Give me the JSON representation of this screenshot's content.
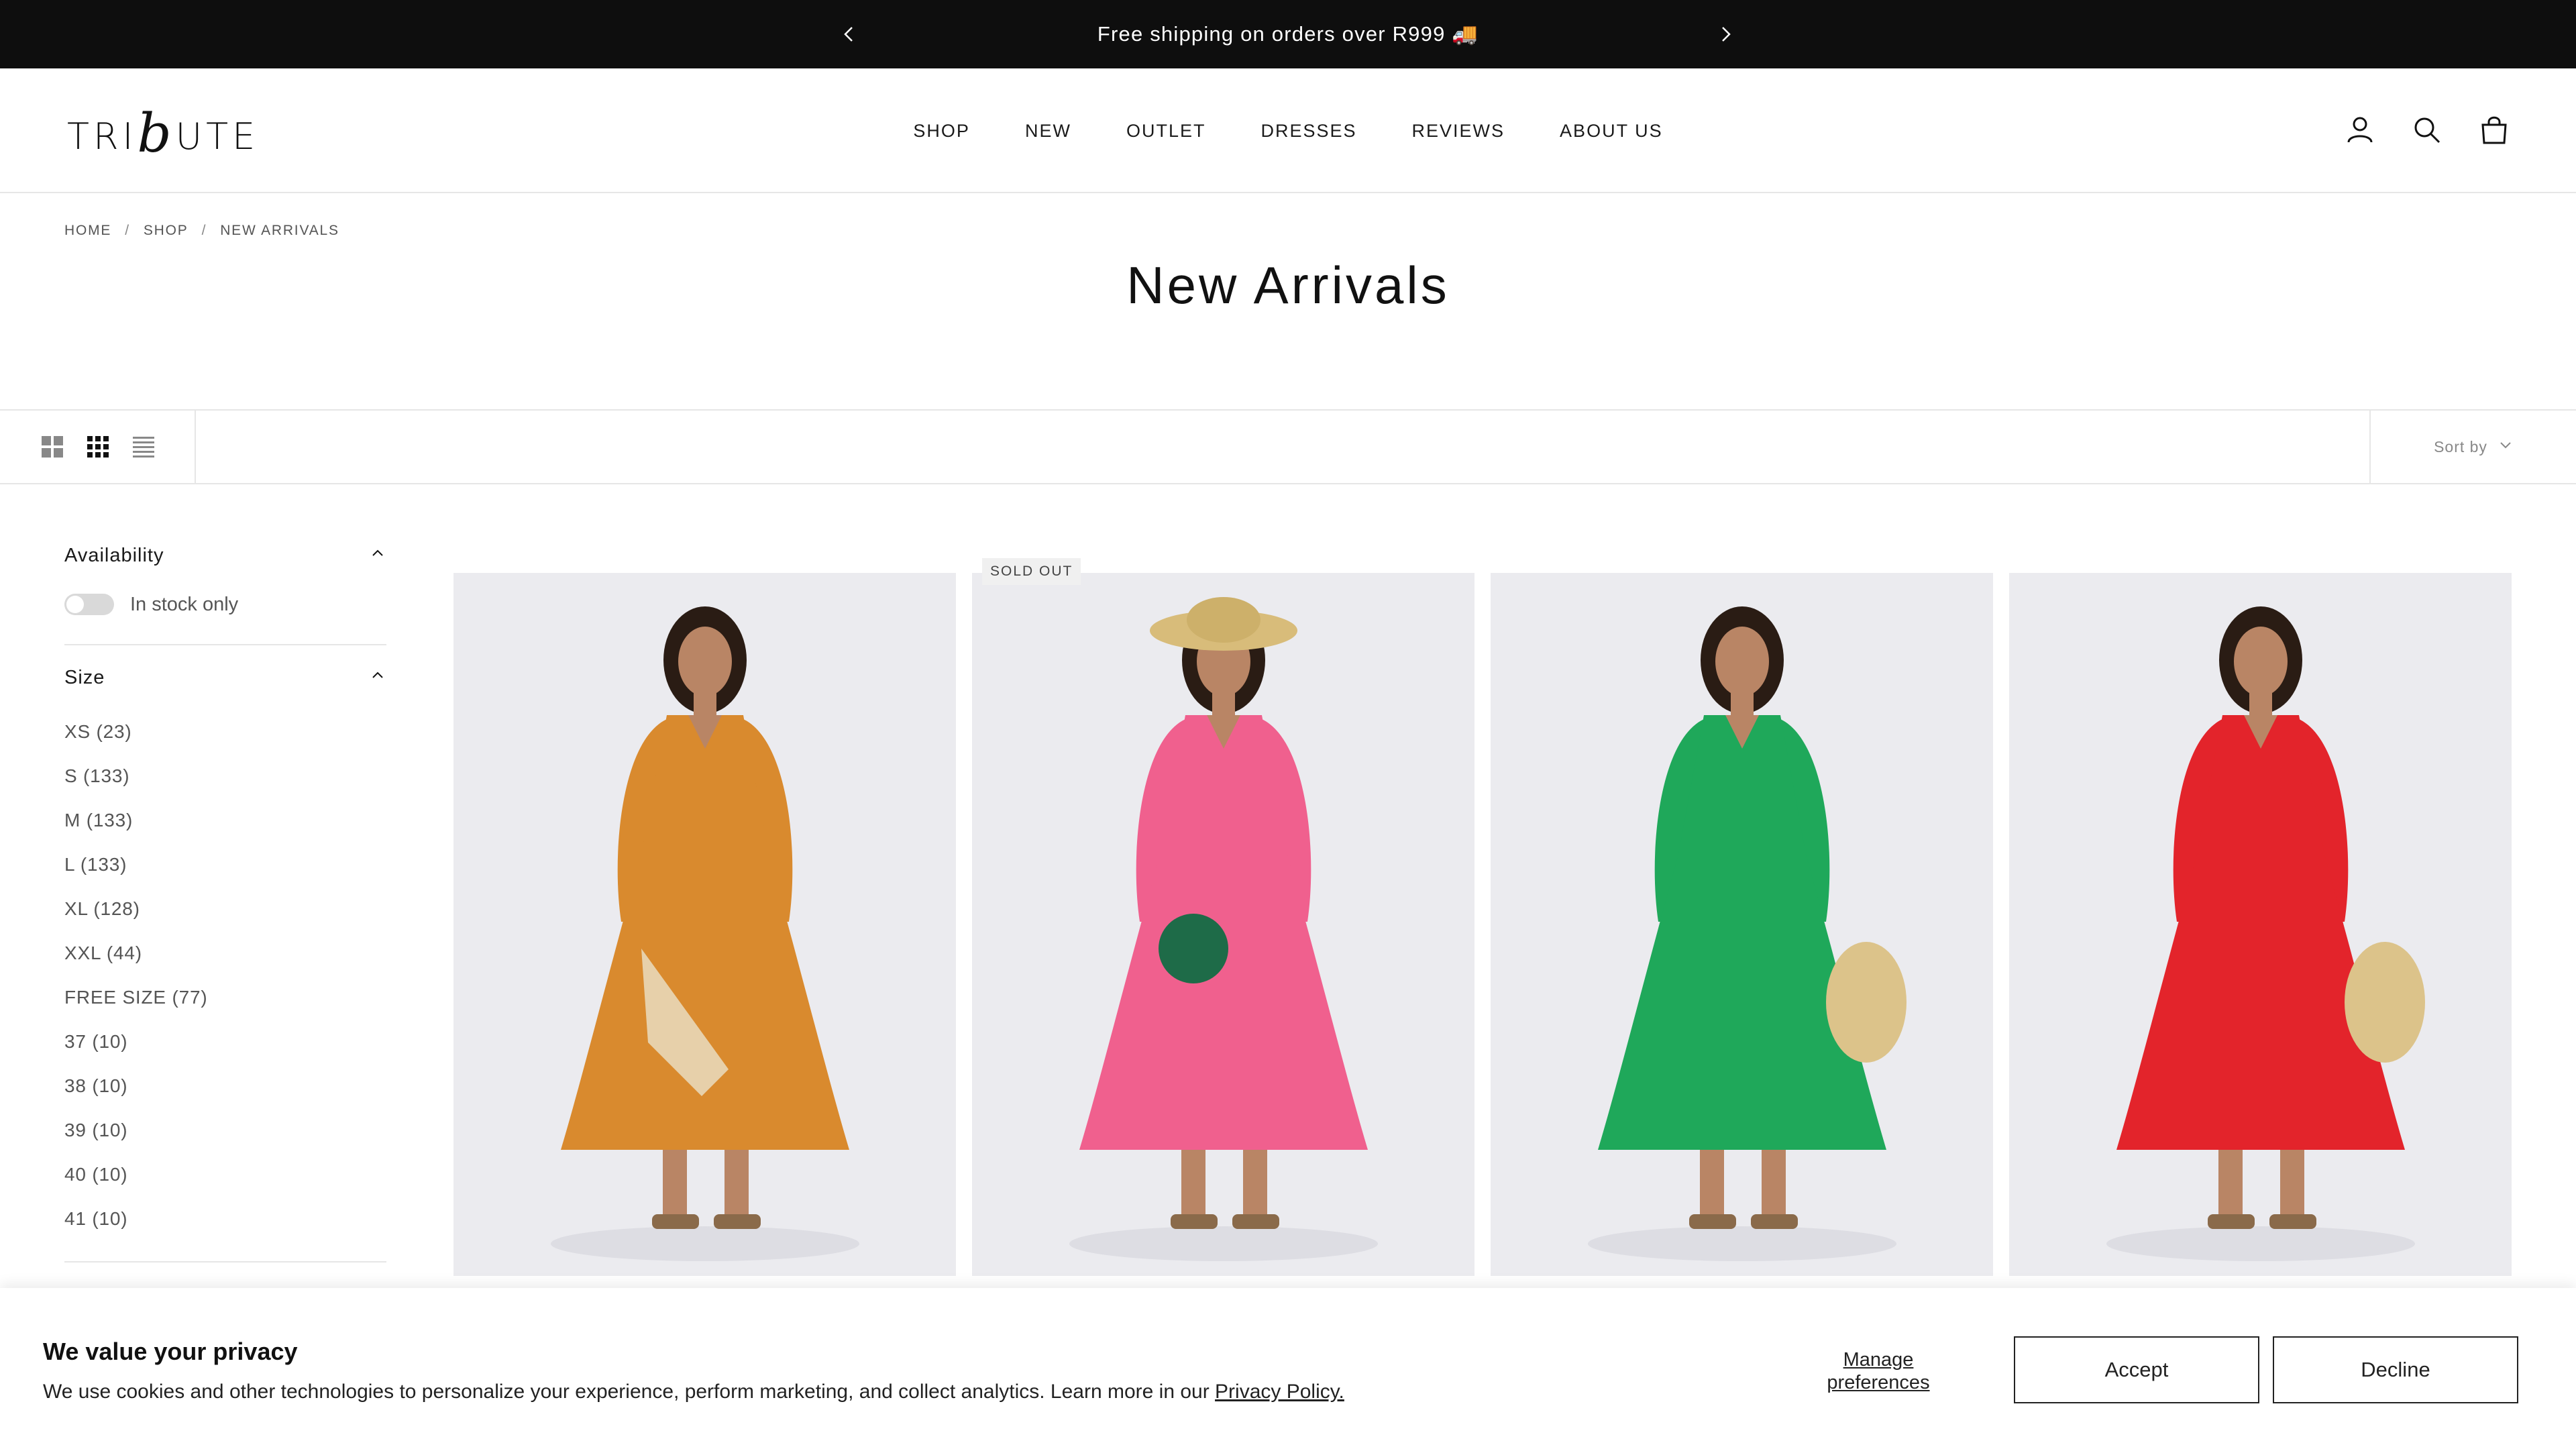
{
  "announcement": {
    "text": "Free shipping on orders over R999 🚚"
  },
  "header": {
    "logo_left": "TRI",
    "logo_mark": "b",
    "logo_right": "UTE",
    "nav": [
      "SHOP",
      "NEW",
      "OUTLET",
      "DRESSES",
      "REVIEWS",
      "ABOUT US"
    ],
    "icons": [
      "account-icon",
      "search-icon",
      "cart-icon"
    ]
  },
  "breadcrumb": [
    "HOME",
    "SHOP",
    "NEW ARRIVALS"
  ],
  "page_title": "New Arrivals",
  "toolbar": {
    "sort_label": "Sort by"
  },
  "filters": {
    "availability": {
      "title": "Availability",
      "toggle_label": "In stock only"
    },
    "size": {
      "title": "Size",
      "options": [
        "XS (23)",
        "S (133)",
        "M (133)",
        "L (133)",
        "XL (128)",
        "XXL (44)",
        "FREE SIZE (77)",
        "37 (10)",
        "38 (10)",
        "39 (10)",
        "40 (10)",
        "41 (10)"
      ]
    }
  },
  "products": [
    {
      "dress_color": "#d98a2e",
      "badge": ""
    },
    {
      "dress_color": "#f0608e",
      "badge": "SOLD OUT"
    },
    {
      "dress_color": "#1fa85a",
      "badge": ""
    },
    {
      "dress_color": "#e3242b",
      "badge": ""
    }
  ],
  "cookie": {
    "title": "We value your privacy",
    "text": "We use cookies and other technologies to personalize your experience, perform marketing, and collect analytics. Learn more in our ",
    "privacy_link": "Privacy Policy.",
    "manage_line1": "Manage",
    "manage_line2": "preferences",
    "accept": "Accept",
    "decline": "Decline"
  }
}
